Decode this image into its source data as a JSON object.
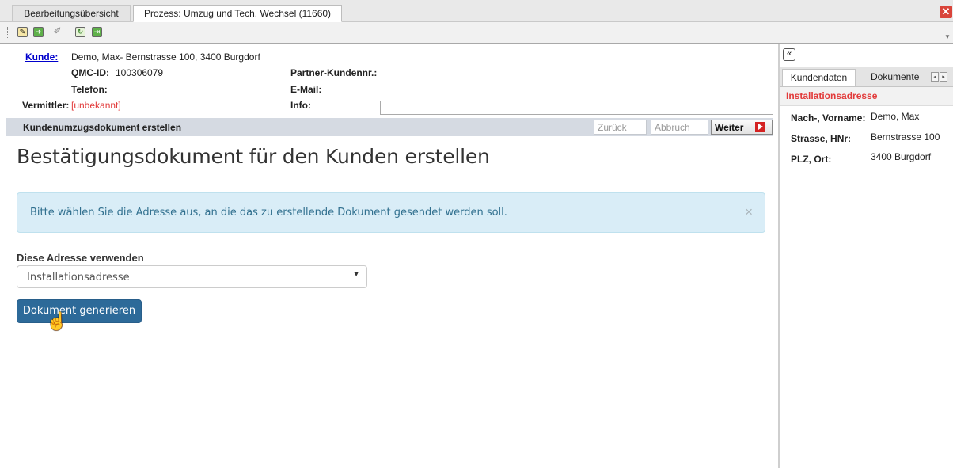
{
  "tabs": [
    {
      "label": "Bearbeitungsübersicht"
    },
    {
      "label": "Prozess: Umzug und Tech. Wechsel (11660)"
    }
  ],
  "window": {
    "close_icon": "close-icon"
  },
  "toolbar": {
    "icons": [
      "document-edit-icon",
      "forward-green-icon",
      "pen-icon",
      "refresh-icon",
      "export-green-icon"
    ]
  },
  "customer": {
    "kunde_label": "Kunde:",
    "kunde_value": "Demo, Max- Bernstrasse 100, 3400 Burgdorf",
    "qmc_label": "QMC-ID:",
    "qmc_value": "100306079",
    "partner_label": "Partner-Kundennr.:",
    "telefon_label": "Telefon:",
    "email_label": "E-Mail:",
    "vermittler_label": "Vermittler:",
    "vermittler_value": "[unbekannt]",
    "info_label": "Info:",
    "info_value": ""
  },
  "step": {
    "title": "Kundenumzugsdokument erstellen",
    "back_label": "Zurück",
    "cancel_label": "Abbruch",
    "next_label": "Weiter"
  },
  "main": {
    "page_title": "Bestätigungsdokument für den Kunden erstellen",
    "alert_text": "Bitte wählen Sie die Adresse aus, an die das zu erstellende Dokument gesendet werden soll.",
    "alert_close": "×",
    "address_label": "Diese Adresse verwenden",
    "address_selected": "Installationsadresse",
    "generate_button": "Dokument generieren"
  },
  "right_panel": {
    "tabs": [
      "Kundendaten",
      "Dokumente"
    ],
    "section_title": "Installationsadresse",
    "fields": [
      {
        "label": "Nach-, Vorname:",
        "value": "Demo, Max"
      },
      {
        "label": "Strasse, HNr:",
        "value": "Bernstrasse 100"
      },
      {
        "label": "PLZ, Ort:",
        "value": "3400 Burgdorf"
      }
    ]
  },
  "colors": {
    "accent_blue": "#2d6a99",
    "alert_bg": "#d9edf7",
    "warning_red": "#e23a3a"
  }
}
